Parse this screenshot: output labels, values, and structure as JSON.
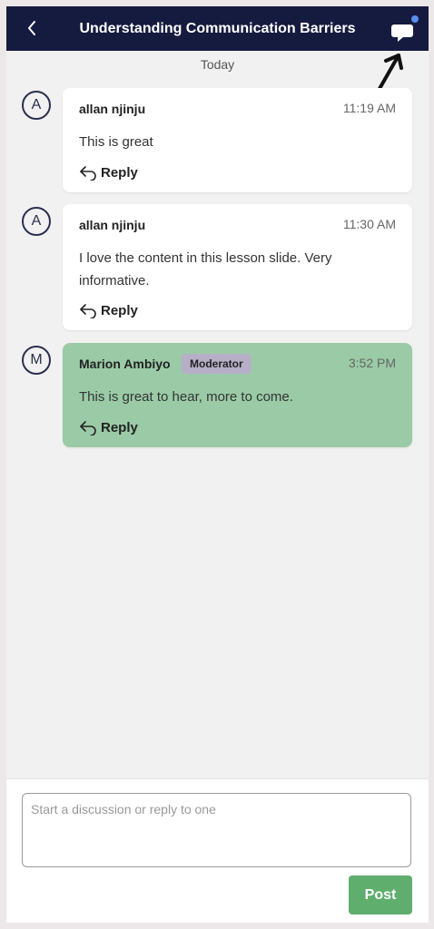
{
  "header": {
    "title": "Understanding Communication Barriers",
    "background": "#151a3f",
    "notification_color": "#5b8df0"
  },
  "day_label": "Today",
  "comments": [
    {
      "avatar": "A",
      "author": "allan njinju",
      "time": "11:19 AM",
      "text": "This is great",
      "reply_label": "Reply"
    },
    {
      "avatar": "A",
      "author": "allan njinju",
      "time": "11:30 AM",
      "text": "I love the content in this lesson slide. Very informative.",
      "reply_label": "Reply"
    },
    {
      "avatar": "M",
      "author": "Marion Ambiyo",
      "badge": "Moderator",
      "time": "3:52 PM",
      "text": "This is great to hear, more to come.",
      "reply_label": "Reply",
      "highlight_color": "#9acba6"
    }
  ],
  "composer": {
    "placeholder": "Start a discussion or reply to one",
    "value": "",
    "post_label": "Post",
    "post_color": "#5fae6e"
  }
}
